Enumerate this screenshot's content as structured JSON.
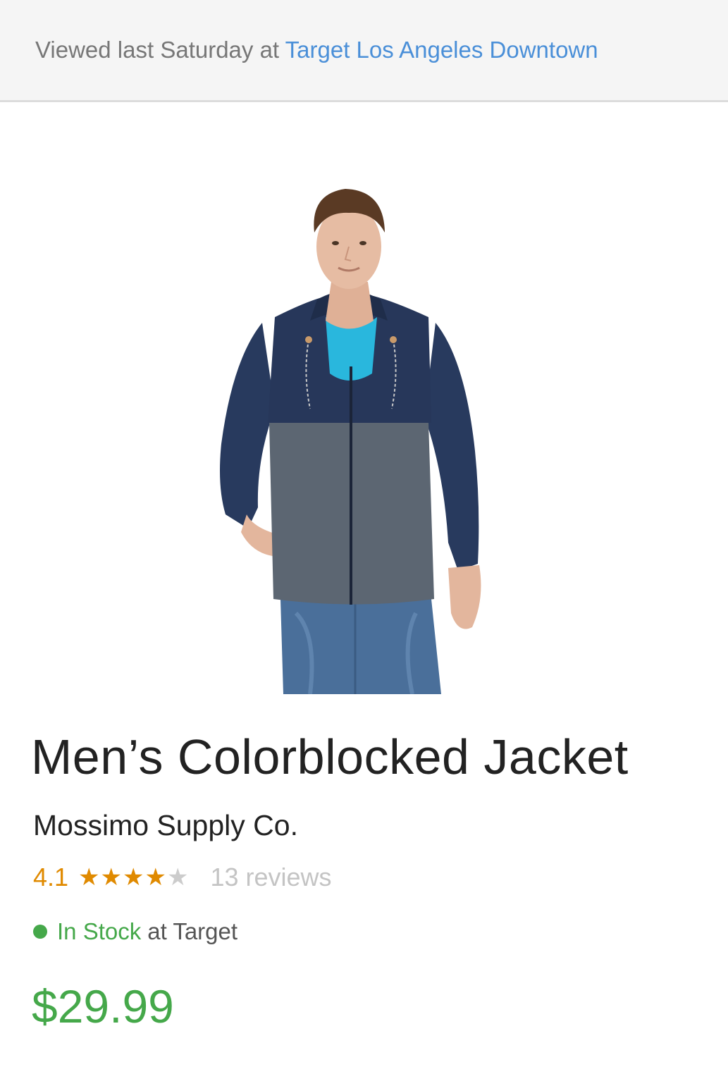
{
  "banner": {
    "prefix": "Viewed last Saturday at ",
    "store_link": "Target Los Angeles Downtown"
  },
  "product": {
    "image_alt": "Man wearing navy and gray colorblocked hooded jacket over turquoise t-shirt with jeans",
    "title": "Men’s Colorblocked Jacket",
    "brand": "Mossimo Supply Co.",
    "rating": "4.1",
    "rating_stars": {
      "value": 4,
      "max": 5
    },
    "reviews": "13 reviews",
    "stock_status": "In Stock",
    "stock_suffix": "at Target",
    "price": "$29.99"
  },
  "colors": {
    "link": "#4a8fd8",
    "rating": "#e08a00",
    "in_stock": "#45a84a",
    "price": "#45a84a"
  },
  "icons": [
    "star-icon",
    "star-empty-icon",
    "status-dot-icon"
  ]
}
